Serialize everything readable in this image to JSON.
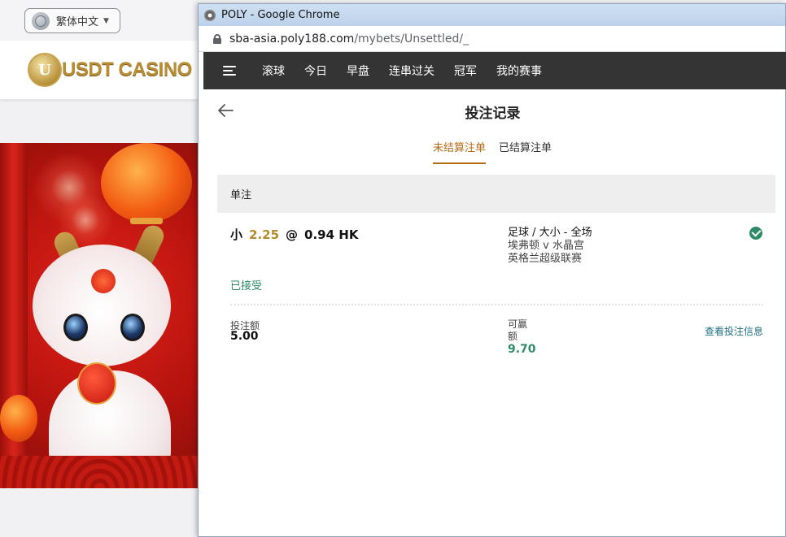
{
  "background": {
    "language_button": "繁体中文",
    "logo_text": "USDT CASINO",
    "logo_mark": "U"
  },
  "browser": {
    "window_title": "POLY - Google Chrome",
    "url_host": "sba-asia.poly188.com",
    "url_path": "/mybets/Unsettled/_"
  },
  "nav": {
    "items": [
      "滚球",
      "今日",
      "早盘",
      "连串过关",
      "冠军",
      "我的赛事"
    ]
  },
  "page": {
    "title": "投注记录",
    "tabs": [
      {
        "label": "未结算注单",
        "active": true
      },
      {
        "label": "已结算注单",
        "active": false
      }
    ],
    "section_title": "单注"
  },
  "bet": {
    "selection": "小",
    "line": "2.25",
    "at": "@",
    "odds": "0.94 HK",
    "market": "足球 / 大小 - 全场",
    "match": "埃弗顿 v 水晶宫",
    "league": "英格兰超级联赛",
    "status": "已接受",
    "stake_label": "投注额",
    "stake_value": "5.00",
    "win_label": "可赢额",
    "win_value": "9.70",
    "view_link": "查看投注信息"
  },
  "colors": {
    "accent": "#b36b13",
    "success": "#2e8b67",
    "navbar": "#343434",
    "link": "#1e7080"
  }
}
